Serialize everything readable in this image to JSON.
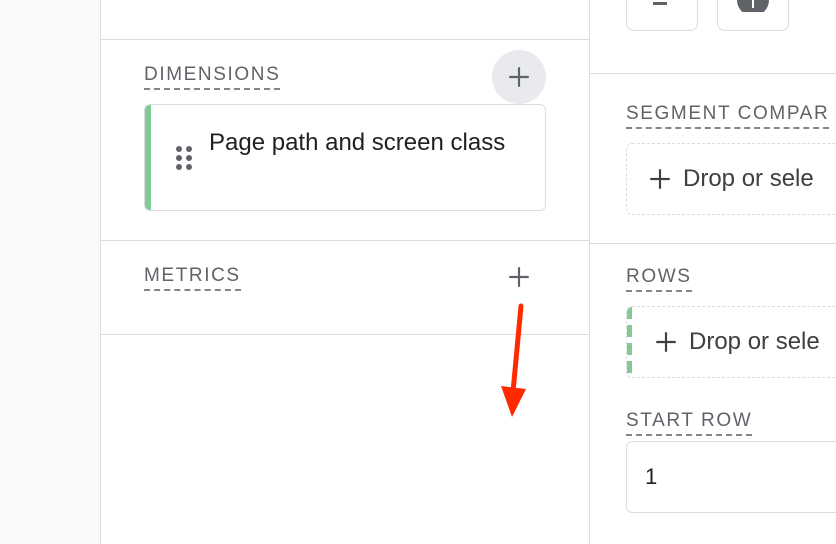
{
  "config_panel": {
    "dimensions_title": "DIMENSIONS",
    "metrics_title": "METRICS",
    "dimension_items": [
      "Page path and screen class"
    ]
  },
  "settings_panel": {
    "segment_title": "SEGMENT COMPAR",
    "segment_drop": "Drop or sele",
    "rows_title": "ROWS",
    "rows_drop": "Drop or sele",
    "start_row_title": "START ROW",
    "start_row_value": "1"
  },
  "colors": {
    "accent_green": "#81c995",
    "annotation_arrow": "#ff2a00"
  },
  "icons": [
    "plus-icon",
    "drag-handle-icon",
    "globe-icon",
    "minus-icon",
    "arrow-annotation"
  ]
}
